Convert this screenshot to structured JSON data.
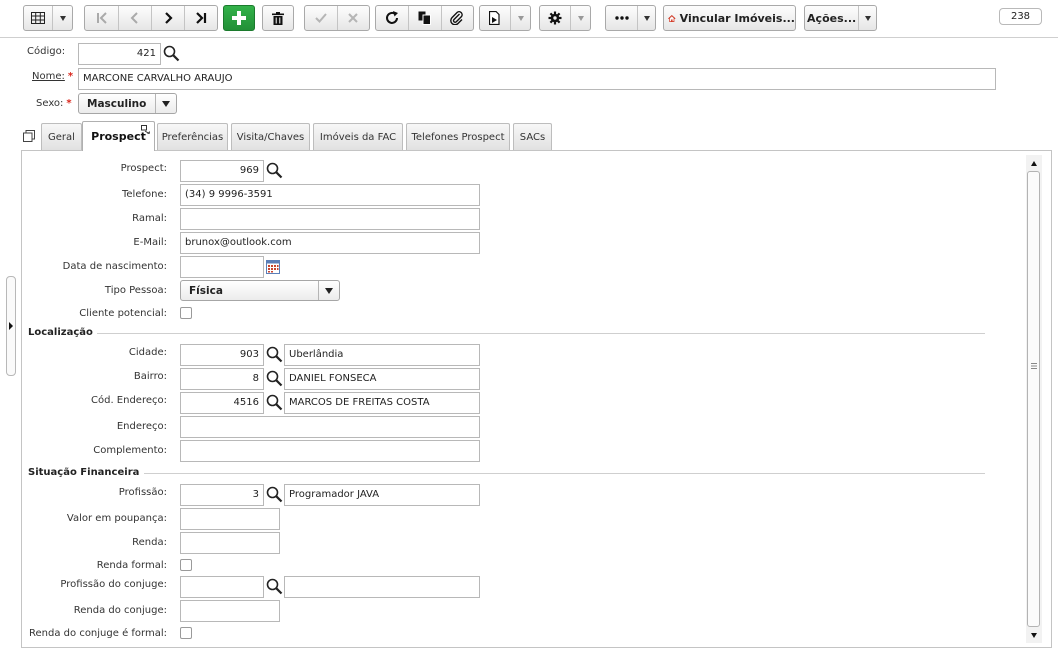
{
  "toolbar": {
    "vincular_label": "Vincular Imóveis...",
    "acoes_label": "Ações...",
    "record_count": "238",
    "colors": {
      "add_green": "#2ba441",
      "house_red": "#d0321e"
    }
  },
  "header": {
    "codigo_label": "Código:",
    "codigo_value": "421",
    "nome_label": "Nome:",
    "nome_value": "MARCONE CARVALHO ARAUJO",
    "sexo_label": "Sexo:",
    "sexo_value": "Masculino"
  },
  "tabs": [
    {
      "label": "Geral",
      "active": false
    },
    {
      "label": "Prospect",
      "active": true
    },
    {
      "label": "Preferências",
      "active": false
    },
    {
      "label": "Visita/Chaves",
      "active": false
    },
    {
      "label": "Imóveis da FAC",
      "active": false
    },
    {
      "label": "Telefones Prospect",
      "active": false
    },
    {
      "label": "SACs",
      "active": false
    }
  ],
  "form": {
    "prospect_label": "Prospect:",
    "prospect_value": "969",
    "telefone_label": "Telefone:",
    "telefone_value": "(34) 9 9996-3591",
    "ramal_label": "Ramal:",
    "ramal_value": "",
    "email_label": "E-Mail:",
    "email_value": "brunox@outlook.com",
    "nascimento_label": "Data de nascimento:",
    "nascimento_value": "",
    "tipo_label": "Tipo Pessoa:",
    "tipo_value": "Física",
    "cliente_label": "Cliente potencial:",
    "cliente_checked": false,
    "localizacao_title": "Localização",
    "cidade_label": "Cidade:",
    "cidade_code": "903",
    "cidade_name": "Uberlândia",
    "bairro_label": "Bairro:",
    "bairro_code": "8",
    "bairro_name": "DANIEL FONSECA",
    "codend_label": "Cód. Endereço:",
    "codend_code": "4516",
    "codend_name": "MARCOS DE FREITAS COSTA",
    "endereco_label": "Endereço:",
    "endereco_value": "",
    "complemento_label": "Complemento:",
    "complemento_value": "",
    "financeira_title": "Situação Financeira",
    "profissao_label": "Profissão:",
    "profissao_code": "3",
    "profissao_name": "Programador JAVA",
    "poupanca_label": "Valor em poupança:",
    "poupanca_value": "",
    "renda_label": "Renda:",
    "renda_value": "",
    "renda_formal_label": "Renda formal:",
    "renda_formal_checked": false,
    "prof_conjuge_label": "Profissão do conjuge:",
    "prof_conjuge_code": "",
    "prof_conjuge_name": "",
    "renda_conjuge_label": "Renda do conjuge:",
    "renda_conjuge_value": "",
    "renda_conjuge_formal_label": "Renda do conjuge é formal:",
    "renda_conjuge_formal_checked": false
  }
}
